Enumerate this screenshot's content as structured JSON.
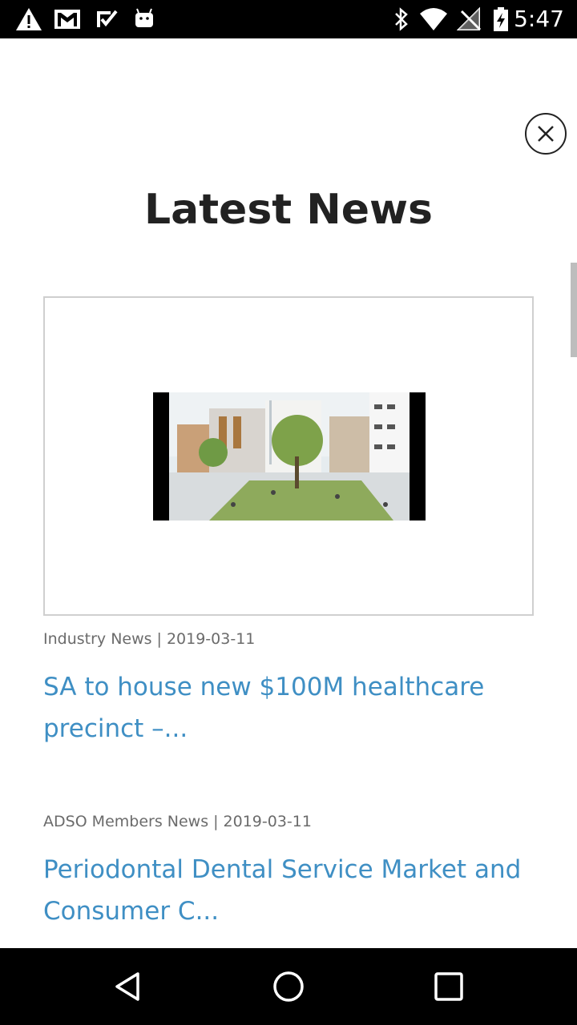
{
  "status_bar": {
    "time": "5:47",
    "icons": [
      "warning-icon",
      "gmail-icon",
      "task-check-icon",
      "android-icon",
      "bluetooth-icon",
      "wifi-icon",
      "no-signal-icon",
      "battery-charging-icon"
    ]
  },
  "page": {
    "title": "Latest News",
    "close_icon": "close-circle-icon"
  },
  "news": [
    {
      "category": "Industry News",
      "separator": "|",
      "date": "2019-03-11",
      "headline": "SA to house new $100M healthcare precinct –..."
    },
    {
      "category": "ADSO Members News",
      "separator": "|",
      "date": "2019-03-11",
      "headline": "Periodontal Dental Service Market and Consumer C..."
    }
  ],
  "nav_bar": {
    "icons": [
      "back-icon",
      "home-icon",
      "recents-icon"
    ]
  }
}
